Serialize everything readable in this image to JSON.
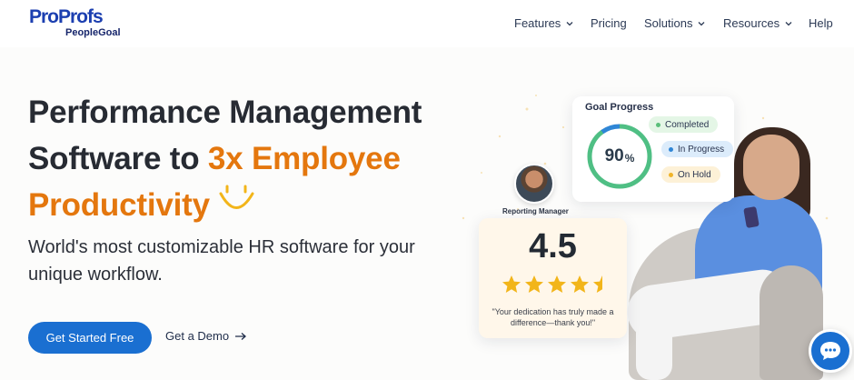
{
  "header": {
    "logo": {
      "brand": "ProProfs",
      "product": "PeopleGoal"
    },
    "nav": [
      {
        "label": "Features",
        "has_dropdown": true
      },
      {
        "label": "Pricing",
        "has_dropdown": false
      },
      {
        "label": "Solutions",
        "has_dropdown": true
      },
      {
        "label": "Resources",
        "has_dropdown": true
      },
      {
        "label": "Help",
        "has_dropdown": false
      }
    ]
  },
  "hero": {
    "title_line1": "Performance Management",
    "title_line2_plain": "Software to ",
    "title_line2_accent": "3x Employee",
    "title_line3_accent": "Productivity",
    "subtitle": "World's most customizable HR software for your unique workflow.",
    "primary_cta": "Get Started Free",
    "secondary_cta": "Get a Demo"
  },
  "illustration": {
    "goal_card": {
      "title": "Goal Progress",
      "percent_value": "90",
      "percent_sign": "%",
      "progress_fraction": 0.9,
      "statuses": [
        {
          "label": "Completed",
          "color": "#5bbf7a",
          "bg": "#e4f6e6"
        },
        {
          "label": "In Progress",
          "color": "#2f86d6",
          "bg": "#dcecfb"
        },
        {
          "label": "On Hold",
          "color": "#f0b429",
          "bg": "#fdf1d7"
        }
      ]
    },
    "manager": {
      "label": "Reporting Manager"
    },
    "rating_card": {
      "rating": "4.5",
      "stars": 4.5,
      "quote": "\"Your dedication has truly made a difference—thank you!\""
    }
  },
  "colors": {
    "brand_blue": "#1a6fd1",
    "accent_orange": "#e4770e",
    "star": "#f2b51a"
  },
  "chat": {
    "icon": "chat-bubble-icon"
  }
}
